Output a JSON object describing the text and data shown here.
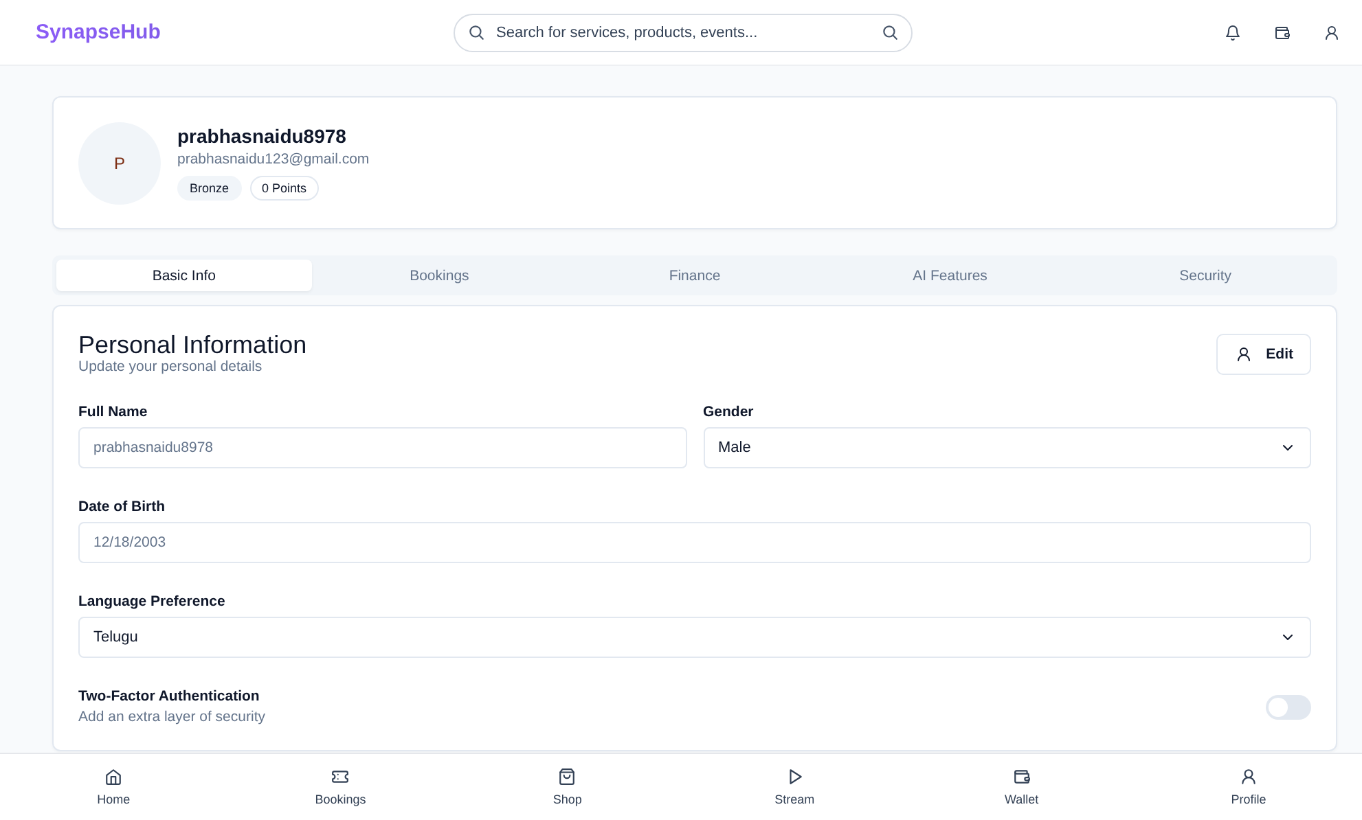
{
  "header": {
    "logo": "SynapseHub",
    "search": {
      "placeholder": "Search for services, products, events..."
    }
  },
  "profile": {
    "initial": "P",
    "username": "prabhasnaidu8978",
    "email": "prabhasnaidu123@gmail.com",
    "badges": [
      {
        "label": "Bronze",
        "kind": "filled"
      },
      {
        "label": "0 Points",
        "kind": "outline"
      }
    ]
  },
  "tabs": [
    {
      "label": "Basic Info",
      "selected": true
    },
    {
      "label": "Bookings",
      "selected": false
    },
    {
      "label": "Finance",
      "selected": false
    },
    {
      "label": "AI Features",
      "selected": false
    },
    {
      "label": "Security",
      "selected": false
    }
  ],
  "form": {
    "title": "Personal Information",
    "subtitle": "Update your personal details",
    "edit_button": "Edit",
    "fields": [
      {
        "label": "Full Name",
        "kind": "text",
        "value": "prabhasnaidu8978",
        "disabled": true
      },
      {
        "label": "Gender",
        "kind": "select",
        "value": "Male",
        "disabled": false
      },
      {
        "label": "Date of Birth",
        "kind": "text",
        "value": "12/18/2003",
        "disabled": true
      },
      {
        "label": "Language Preference",
        "kind": "select",
        "value": "Telugu",
        "disabled": false
      }
    ],
    "two_factor": {
      "label": "Two-Factor Authentication",
      "description": "Add an extra layer of security",
      "on": false
    }
  },
  "bottom_nav": [
    {
      "label": "Home",
      "selected": false
    },
    {
      "label": "Bookings",
      "selected": false
    },
    {
      "label": "Shop",
      "selected": false
    },
    {
      "label": "Stream",
      "selected": false
    },
    {
      "label": "Wallet",
      "selected": false
    },
    {
      "label": "Profile",
      "selected": false
    }
  ]
}
